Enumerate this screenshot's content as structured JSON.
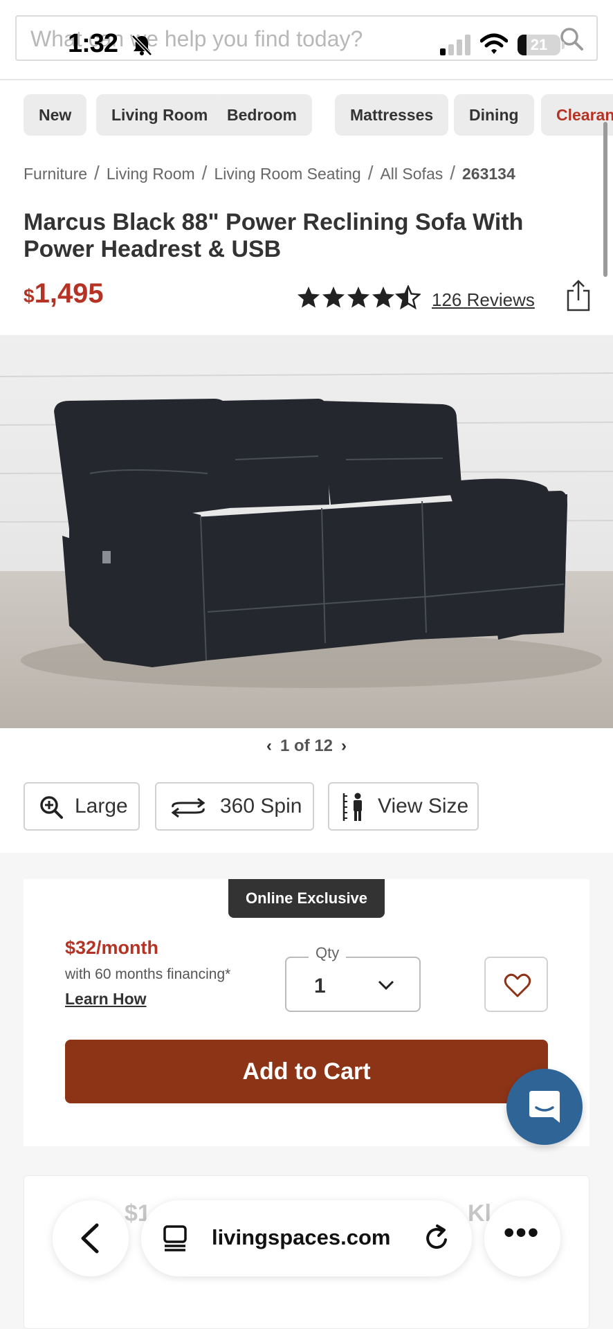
{
  "status_bar": {
    "time": "1:32",
    "battery": "21"
  },
  "search": {
    "placeholder": "What can we help you find today?"
  },
  "categories": [
    "New",
    "Living Room",
    "Bedroom",
    "Mattresses",
    "Dining",
    "Clearance"
  ],
  "breadcrumb": [
    "Furniture",
    "Living Room",
    "Living Room Seating",
    "All Sofas",
    "263134"
  ],
  "product": {
    "title": "Marcus Black 88\" Power Reclining Sofa With Power Headrest & USB",
    "price_currency": "$",
    "price": "1,495",
    "rating": 4.5,
    "reviews": "126 Reviews",
    "image_counter": "1 of 12"
  },
  "view_buttons": {
    "large": "Large",
    "spin": "360 Spin",
    "size": "View Size"
  },
  "purchase": {
    "badge": "Online Exclusive",
    "monthly": "$32/month",
    "financing": "with 60 months financing*",
    "learn_how": "Learn How",
    "qty_label": "Qty",
    "qty_value": "1",
    "add_to_cart": "Add to Cart"
  },
  "card2": {
    "partial_text": "$1",
    "partial_text_right": "Kl"
  },
  "browser": {
    "domain": "livingspaces.com"
  },
  "colors": {
    "accent_red": "#b53324",
    "cart_button": "#8d3417",
    "chat_button": "#2f6496"
  }
}
